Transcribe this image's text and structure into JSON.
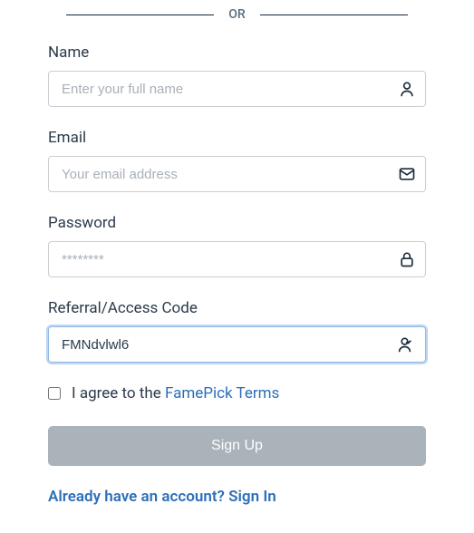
{
  "divider": "OR",
  "name": {
    "label": "Name",
    "placeholder": "Enter your full name",
    "value": ""
  },
  "email": {
    "label": "Email",
    "placeholder": "Your email address",
    "value": ""
  },
  "password": {
    "label": "Password",
    "placeholder": "********",
    "value": ""
  },
  "referral": {
    "label": "Referral/Access Code",
    "placeholder": "",
    "value": "FMNdvlwl6"
  },
  "terms": {
    "checked": false,
    "prefix": "I agree to the ",
    "link_text": "FamePick Terms"
  },
  "signup_button": "Sign Up",
  "signin_link": "Already have an account? Sign In",
  "colors": {
    "accent": "#2b6fb8",
    "button_disabled": "#aab2ba",
    "focus_ring": "#bcd6f3"
  }
}
